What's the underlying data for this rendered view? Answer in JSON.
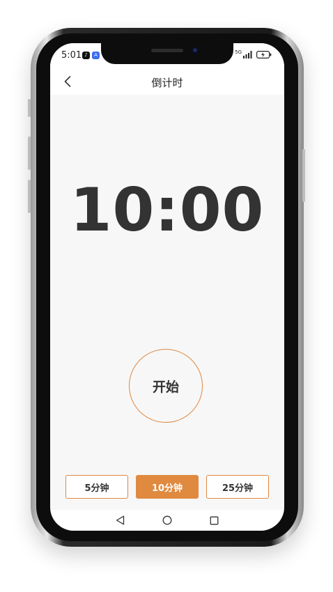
{
  "status_bar": {
    "time": "5:01",
    "network_label": "5G"
  },
  "header": {
    "title": "倒计时"
  },
  "timer": {
    "display": "10:00"
  },
  "controls": {
    "start_label": "开始"
  },
  "presets": [
    {
      "label": "5分钟",
      "active": false
    },
    {
      "label": "10分钟",
      "active": true
    },
    {
      "label": "25分钟",
      "active": false
    }
  ],
  "colors": {
    "accent": "#e08a40",
    "timer_text": "#333333",
    "background": "#f7f7f7"
  },
  "icons": {
    "back": "chevron-left-icon",
    "wifi": "wifi-icon",
    "signal": "signal-icon",
    "battery": "battery-charging-icon",
    "nav_back": "triangle-back-icon",
    "nav_home": "circle-home-icon",
    "nav_recent": "square-recent-icon"
  }
}
